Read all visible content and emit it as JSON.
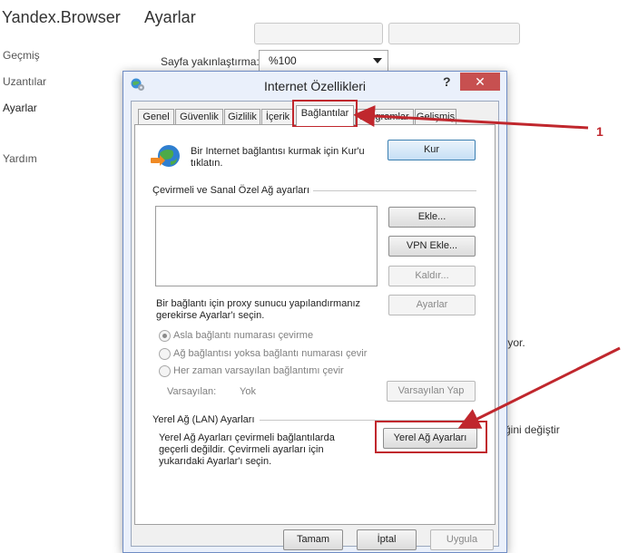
{
  "browser": {
    "app_title": "Yandex.Browser",
    "page_title": "Ayarlar"
  },
  "sidebar": {
    "items": [
      {
        "label": "Geçmiş"
      },
      {
        "label": "Uzantılar"
      },
      {
        "label": "Ayarlar"
      },
      {
        "label": "Yardım"
      }
    ]
  },
  "settings": {
    "zoom_label": "Sayfa yakınlaştırma:",
    "zoom_value": "%100",
    "bg_text_1": "ıyor.",
    "bg_text_2": "ğini değiştir"
  },
  "dialog": {
    "title": "Internet Özellikleri",
    "help": "?",
    "close": "✕",
    "tabs": [
      {
        "label": "Genel"
      },
      {
        "label": "Güvenlik"
      },
      {
        "label": "Gizlilik"
      },
      {
        "label": "İçerik"
      },
      {
        "label": "Bağlantılar"
      },
      {
        "label": "Programlar"
      },
      {
        "label": "Gelişmiş"
      }
    ],
    "active_tab": "Bağlantılar",
    "setup_text": "Bir Internet bağlantısı kurmak için Kur'u tıklatın.",
    "setup_button": "Kur",
    "dialup_header": "Çevirmeli ve Sanal Özel Ağ ayarları",
    "add_button": "Ekle...",
    "add_vpn_button": "VPN Ekle...",
    "remove_button": "Kaldır...",
    "settings_button": "Ayarlar",
    "proxy_text": "Bir bağlantı için proxy sunucu yapılandırmanız gerekirse Ayarlar'ı seçin.",
    "radio_options": [
      {
        "label": "Asla bağlantı numarası çevirme",
        "checked": true
      },
      {
        "label": "Ağ bağlantısı yoksa bağlantı numarası çevir",
        "checked": false
      },
      {
        "label": "Her zaman varsayılan bağlantımı çevir",
        "checked": false
      }
    ],
    "default_label": "Varsayılan:",
    "default_value": "Yok",
    "set_default_button": "Varsayılan Yap",
    "lan_header": "Yerel Ağ (LAN) Ayarları",
    "lan_text": "Yerel Ağ Ayarları çevirmeli bağlantılarda geçerli değildir. Çevirmeli ayarları için yukarıdaki Ayarlar'ı seçin.",
    "lan_button": "Yerel Ağ Ayarları",
    "ok_button": "Tamam",
    "cancel_button": "İptal",
    "apply_button": "Uygula"
  },
  "annotation": {
    "step_number": "1",
    "color": "#c0272d"
  },
  "colors": {
    "accent": "#c0272d",
    "close": "#c75050",
    "dialog_frame": "#6f8cc4"
  }
}
